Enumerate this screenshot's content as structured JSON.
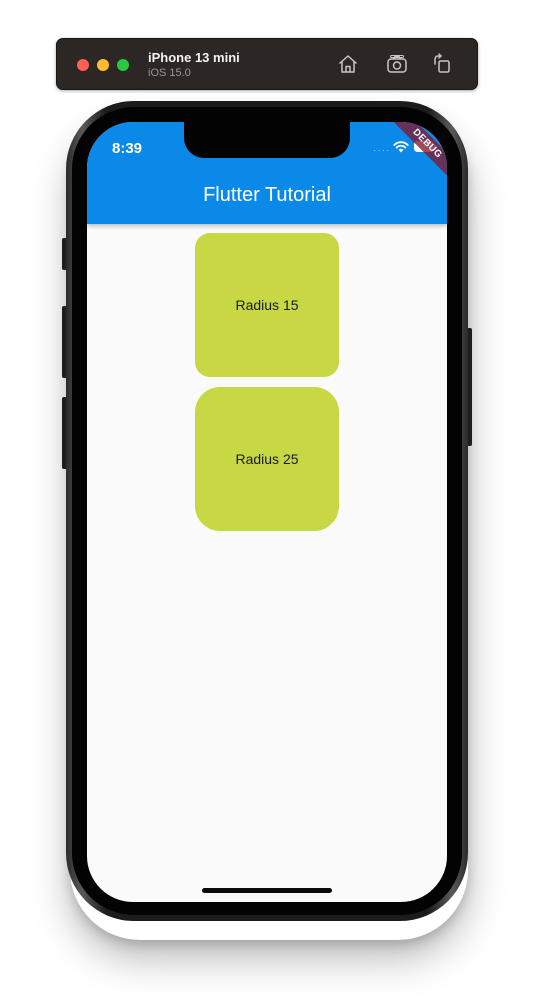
{
  "simulator": {
    "device_name": "iPhone 13 mini",
    "os_version": "iOS 15.0",
    "buttons": {
      "home_icon": "home-icon",
      "screenshot_icon": "camera-icon",
      "rotate_icon": "rotate-icon"
    }
  },
  "status_bar": {
    "time": "8:39",
    "signal_dots": "․․․․"
  },
  "app_bar": {
    "title": "Flutter Tutorial",
    "color": "#0b89e8"
  },
  "debug_banner": {
    "label": "DEBUG"
  },
  "cards": [
    {
      "label": "Radius 15",
      "color": "#c8d744"
    },
    {
      "label": "Radius 25",
      "color": "#c8d744"
    }
  ]
}
